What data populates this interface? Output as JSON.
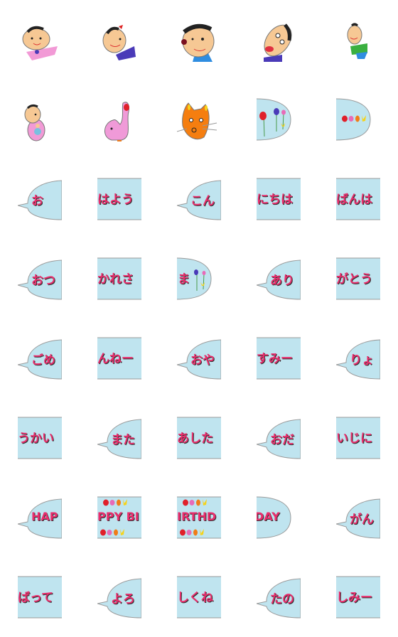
{
  "colors": {
    "bubble": "#bfe4ef",
    "outline": "#9a9a9a",
    "text": "#ea2d6c",
    "shadow": "#333333"
  },
  "cells": [
    {
      "kind": "character",
      "icon": "boy-pink-shirt"
    },
    {
      "kind": "character",
      "icon": "girl-red-bow"
    },
    {
      "kind": "character",
      "icon": "boy-big-head"
    },
    {
      "kind": "character",
      "icon": "boy-shouting"
    },
    {
      "kind": "character",
      "icon": "boy-green-shirt"
    },
    {
      "kind": "character",
      "icon": "baby-with-doll"
    },
    {
      "kind": "character",
      "icon": "pink-elephant"
    },
    {
      "kind": "character",
      "icon": "orange-cat"
    },
    {
      "kind": "bubble",
      "shape": "right",
      "deco": "tulip-stems",
      "text": ""
    },
    {
      "kind": "bubble",
      "shape": "right",
      "deco": "tulip-row",
      "text": ""
    },
    {
      "kind": "bubble",
      "shape": "left",
      "text": "お"
    },
    {
      "kind": "bubble",
      "shape": "mid",
      "text": "はよう"
    },
    {
      "kind": "bubble",
      "shape": "left",
      "text": "こん"
    },
    {
      "kind": "bubble",
      "shape": "mid",
      "text": "にちは"
    },
    {
      "kind": "bubble",
      "shape": "mid",
      "text": "ばんは"
    },
    {
      "kind": "bubble",
      "shape": "left",
      "text": "おつ"
    },
    {
      "kind": "bubble",
      "shape": "mid",
      "text": "かれさ"
    },
    {
      "kind": "bubble",
      "shape": "right",
      "deco": "small-flowers",
      "text": "ま"
    },
    {
      "kind": "bubble",
      "shape": "left",
      "text": "あり"
    },
    {
      "kind": "bubble",
      "shape": "mid",
      "text": "がとう"
    },
    {
      "kind": "bubble",
      "shape": "left",
      "text": "ごめ"
    },
    {
      "kind": "bubble",
      "shape": "mid",
      "text": "んねー"
    },
    {
      "kind": "bubble",
      "shape": "left",
      "text": "おや"
    },
    {
      "kind": "bubble",
      "shape": "mid",
      "text": "すみー"
    },
    {
      "kind": "bubble",
      "shape": "left",
      "text": "りょ"
    },
    {
      "kind": "bubble",
      "shape": "mid",
      "text": "うかい"
    },
    {
      "kind": "bubble",
      "shape": "left",
      "text": "また"
    },
    {
      "kind": "bubble",
      "shape": "mid",
      "text": "あした"
    },
    {
      "kind": "bubble",
      "shape": "left",
      "text": "おだ"
    },
    {
      "kind": "bubble",
      "shape": "mid",
      "text": "いじに"
    },
    {
      "kind": "bubble",
      "shape": "left",
      "text": "HAP",
      "latin": true
    },
    {
      "kind": "bubble",
      "shape": "mid",
      "deco": "tulip-bands",
      "text": "PPY BI",
      "latin": true
    },
    {
      "kind": "bubble",
      "shape": "mid",
      "deco": "tulip-bands",
      "text": "IRTHD",
      "latin": true
    },
    {
      "kind": "bubble",
      "shape": "right",
      "text": "DAY",
      "latin": true
    },
    {
      "kind": "bubble",
      "shape": "left",
      "text": "がん"
    },
    {
      "kind": "bubble",
      "shape": "mid",
      "text": "ばって"
    },
    {
      "kind": "bubble",
      "shape": "left",
      "text": "よろ"
    },
    {
      "kind": "bubble",
      "shape": "mid",
      "text": "しくね"
    },
    {
      "kind": "bubble",
      "shape": "left",
      "text": "たの"
    },
    {
      "kind": "bubble",
      "shape": "mid",
      "text": "しみー"
    }
  ]
}
